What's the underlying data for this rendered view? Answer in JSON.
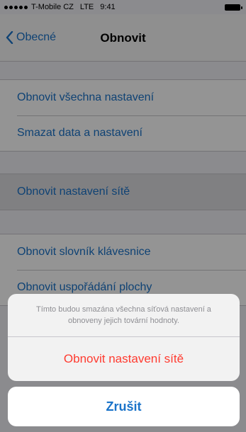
{
  "status_bar": {
    "carrier": "T-Mobile CZ",
    "network": "LTE",
    "time": "9:41"
  },
  "nav": {
    "back_label": "Obecné",
    "title": "Obnovit"
  },
  "groups": {
    "first": [
      "Obnovit všechna nastavení",
      "Smazat data a nastavení"
    ],
    "second": [
      "Obnovit nastavení sítě"
    ],
    "third": [
      "Obnovit slovník klávesnice",
      "Obnovit uspořádání plochy"
    ]
  },
  "action_sheet": {
    "message": "Tímto budou smazána všechna síťová nastavení a obnoveny jejich tovární hodnoty.",
    "destructive_label": "Obnovit nastavení sítě",
    "cancel_label": "Zrušit"
  },
  "colors": {
    "link_blue": "#1a73c9",
    "destructive_red": "#ff3b30",
    "dim_overlay": "rgba(0,0,0,0.42)"
  }
}
